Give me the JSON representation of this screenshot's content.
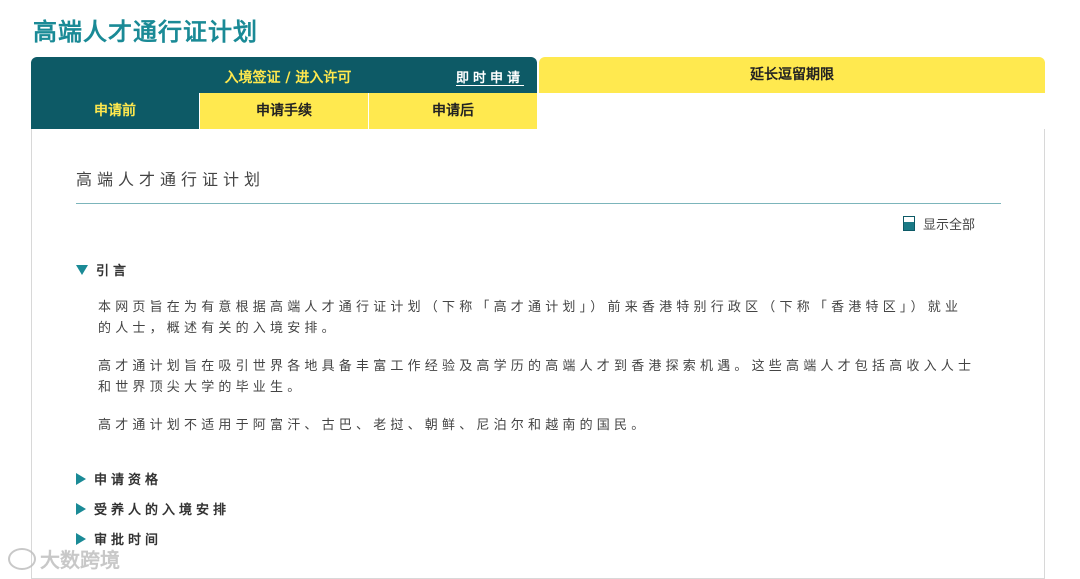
{
  "page": {
    "title": "高端人才通行证计划"
  },
  "tabs": {
    "entry_label": "入境签证 / 进入许可",
    "apply_now_label": "即时申请",
    "extend_label": "延长逗留期限"
  },
  "subtabs": {
    "before": "申请前",
    "procedures": "申请手续",
    "after": "申请后"
  },
  "content": {
    "title": "高端人才通行证计划",
    "show_all_label": "显示全部",
    "sections": {
      "intro": {
        "label": "引言",
        "paragraphs": [
          "本网页旨在为有意根据高端人才通行证计划（下称「高才通计划」）前来香港特别行政区（下称「香港特区」）就业的人士，概述有关的入境安排。",
          "高才通计划旨在吸引世界各地具备丰富工作经验及高学历的高端人才到香港探索机遇。这些高端人才包括高收入人士和世界顶尖大学的毕业生。",
          "高才通计划不适用于阿富汗、古巴、老挝、朝鲜、尼泊尔和越南的国民。"
        ]
      },
      "eligibility": {
        "label": "申请资格"
      },
      "dependants": {
        "label": "受养人的入境安排"
      },
      "processing_time": {
        "label": "审批时间"
      }
    }
  },
  "watermark": {
    "text": "大数跨境"
  },
  "colors": {
    "teal_dark": "#0d5a66",
    "teal_title": "#1a8a96",
    "yellow": "#ffe94f",
    "yellow_text": "#ffe84d"
  }
}
